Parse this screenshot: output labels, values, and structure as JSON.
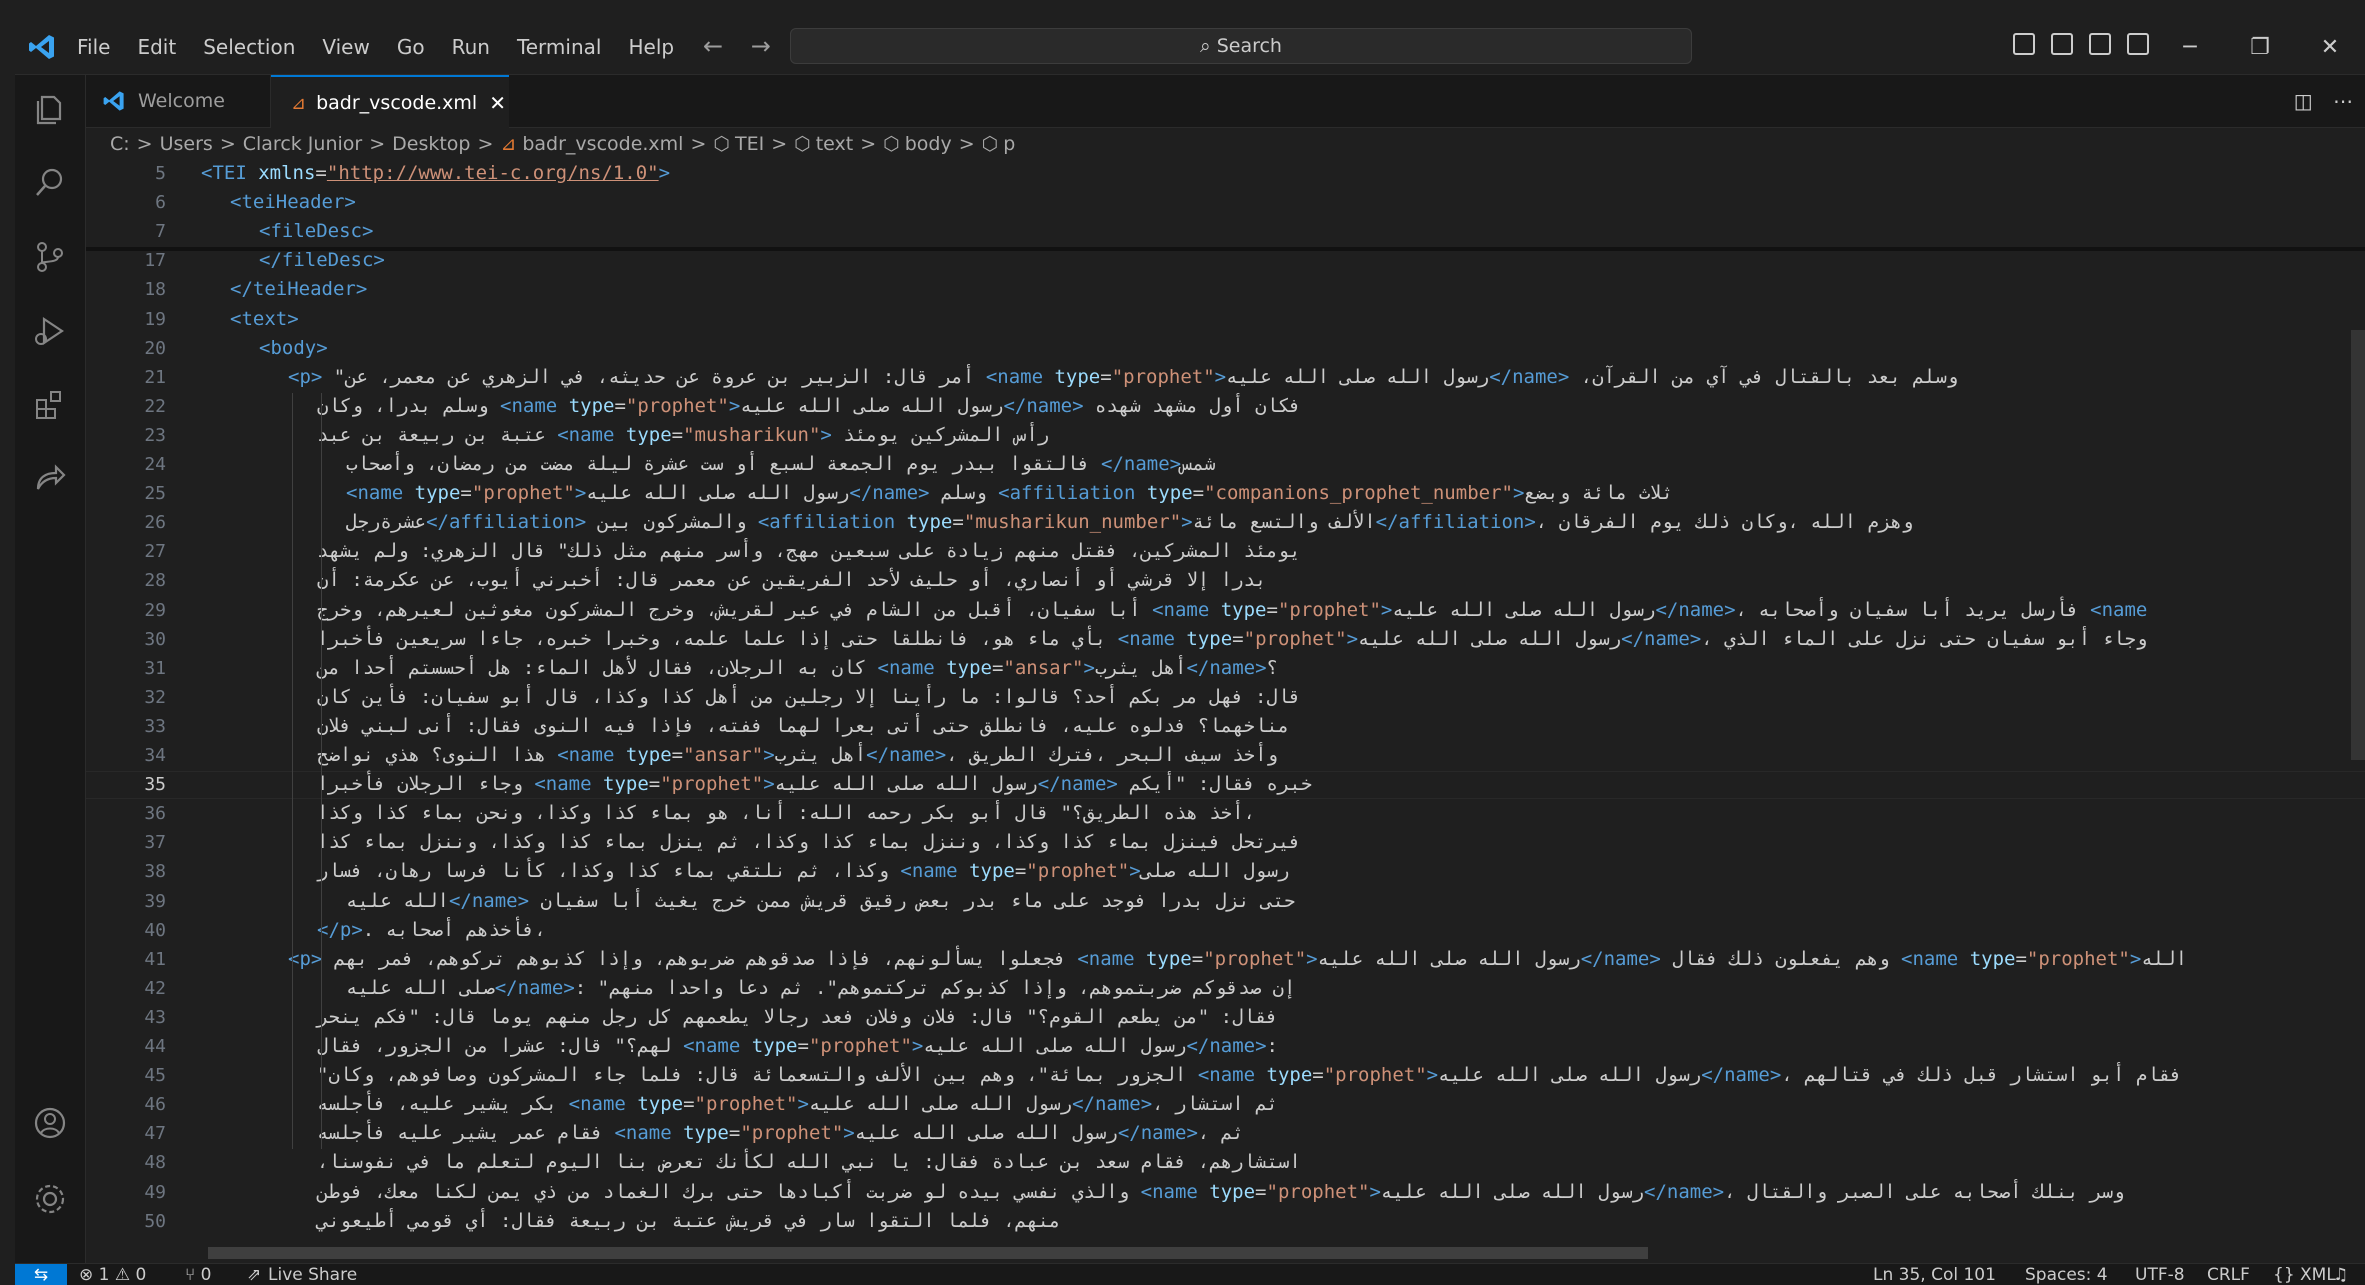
{
  "menu": [
    "File",
    "Edit",
    "Selection",
    "View",
    "Go",
    "Run",
    "Terminal",
    "Help"
  ],
  "search_label": "Search",
  "tabs": [
    {
      "label": "Welcome",
      "active": false
    },
    {
      "label": "badr_vscode.xml",
      "active": true,
      "close": "✕"
    }
  ],
  "breadcrumb": [
    "C:",
    "Users",
    "Clarck Junior",
    "Desktop",
    "badr_vscode.xml",
    "TEI",
    "text",
    "body",
    "p"
  ],
  "cursor_line": "35",
  "lines": [
    {
      "n": "5",
      "ind": 0,
      "h": "<span class=t>&lt;TEI</span> <span class=a>xmlns</span>=<span class=u>\"http://www.tei-c.org/ns/1.0\"</span><span class=t>&gt;</span>"
    },
    {
      "n": "6",
      "ind": 1,
      "h": "<span class=t>&lt;teiHeader&gt;</span>"
    },
    {
      "n": "7",
      "ind": 2,
      "h": "<span class=t>&lt;fileDesc&gt;</span>"
    },
    {
      "n": "17",
      "ind": 2,
      "h": "<span class=t>&lt;/fileDesc&gt;</span>"
    },
    {
      "n": "18",
      "ind": 1,
      "h": "<span class=t>&lt;/teiHeader&gt;</span>"
    },
    {
      "n": "19",
      "ind": 1,
      "h": "<span class=t>&lt;text&gt;</span>"
    },
    {
      "n": "20",
      "ind": 2,
      "h": "<span class=t>&lt;body&gt;</span>"
    },
    {
      "n": "21",
      "ind": 3,
      "h": "<span class=t>&lt;p&gt;</span> \"أمر قال: الزبير بن عروة عن حديثه، في الزهري عن معمر، عن <span class=t>&lt;name</span> <span class=a>type</span>=<span class=s>\"prophet\"</span><span class=t>&gt;</span>رسول الله صلى الله عليه<span class=t>&lt;/name&gt;</span> ،وسلم بعد بالقتال في آي من القرآن"
    },
    {
      "n": "22",
      "ind": 4,
      "h": "وسلم بدرا، وكان <span class=t>&lt;name</span> <span class=a>type</span>=<span class=s>\"prophet\"</span><span class=t>&gt;</span>رسول الله صلى الله عليه<span class=t>&lt;/name&gt;</span> فكان أول مشهد شهده"
    },
    {
      "n": "23",
      "ind": 4,
      "h": "عتبة بن ربيعة بن عبد <span class=t>&lt;name</span> <span class=a>type</span>=<span class=s>\"musharikun\"</span><span class=t>&gt;</span> رأس المشركين يومئذ"
    },
    {
      "n": "24",
      "ind": 5,
      "h": "فالتقوا ببدر يوم الجمعة لسبع أو ست عشرة ليلة مضت من رمضان، وأصحاب <span class=t>&lt;/name&gt;</span>شمس"
    },
    {
      "n": "25",
      "ind": 5,
      "h": "<span class=t>&lt;name</span> <span class=a>type</span>=<span class=s>\"prophet\"</span><span class=t>&gt;</span>رسول الله صلى الله عليه<span class=t>&lt;/name&gt;</span> وسلم <span class=t>&lt;affiliation</span> <span class=a>type</span>=<span class=s>\"companions_prophet_number\"</span><span class=t>&gt;</span>ثلاث مائة وبضع"
    },
    {
      "n": "26",
      "ind": 5,
      "h": "عشرةرجل<span class=t>&lt;/affiliation&gt;</span> والمشركون بين <span class=t>&lt;affiliation</span> <span class=a>type</span>=<span class=s>\"musharikun_number\"</span><span class=t>&gt;</span>الألف والتسع مائة<span class=t>&lt;/affiliation&gt;</span>، وهزم الله ،وكان ذلك يوم الفرقان"
    },
    {
      "n": "27",
      "ind": 4,
      "h": "يومئذ المشركين، فقتل منهم زيادة على سبعين مهج، وأسر منهم مثل ذلك\" قال الزهري: ولم يشهد"
    },
    {
      "n": "28",
      "ind": 4,
      "h": "بدرا إلا قرشي أو أنصاري، أو حليف لأحد الفريقين عن معمر قال: أخبرني أيوب، عن عكرمة: أن"
    },
    {
      "n": "29",
      "ind": 4,
      "h": "أبا سفيان، أقبل من الشام في عير لقريش، وخرج المشركون مغوثين لعيرهم، وخرج <span class=t>&lt;name</span> <span class=a>type</span>=<span class=s>\"prophet\"</span><span class=t>&gt;</span>رسول الله صلى الله عليه<span class=t>&lt;/name&gt;</span>، فأرسل يريد أبا سفيان وأصحابه <span class=t>&lt;name</span>"
    },
    {
      "n": "30",
      "ind": 4,
      "h": "بأي ماء هو، فانطلقا حتى إذا علما علمه، وخبرا خبره، جاءا سريعين فأخبرا <span class=t>&lt;name</span> <span class=a>type</span>=<span class=s>\"prophet\"</span><span class=t>&gt;</span>رسول الله صلى الله عليه<span class=t>&lt;/name&gt;</span>، وجاء أبو سفيان حتى نزل على الماء الذي"
    },
    {
      "n": "31",
      "ind": 4,
      "h": "كان به الرجلان، فقال لأهل الماء: هل أحسستم أحدا من <span class=t>&lt;name</span> <span class=a>type</span>=<span class=s>\"ansar\"</span><span class=t>&gt;</span>أهل يثرب<span class=t>&lt;/name&gt;</span>؟"
    },
    {
      "n": "32",
      "ind": 4,
      "h": "قال: فهل مر بكم أحد؟ قالوا: ما رأينا إلا رجلين من أهل كذا وكذا، قال أبو سفيان: فأين كان"
    },
    {
      "n": "33",
      "ind": 4,
      "h": "مناخهما؟ فدلوه عليه، فانطلق حتى أتى بعرا لهما ففته، فإذا فيه النوى فقال: أنى لبني فلان"
    },
    {
      "n": "34",
      "ind": 4,
      "h": "هذا النوى؟ هذي نواضح <span class=t>&lt;name</span> <span class=a>type</span>=<span class=s>\"ansar\"</span><span class=t>&gt;</span>أهل يثرب<span class=t>&lt;/name&gt;</span>، وأخذ سيف البحر ،فترك الطريق"
    },
    {
      "n": "35",
      "ind": 4,
      "h": "وجاء الرجلان فأخبرا <span class=t>&lt;name</span> <span class=a>type</span>=<span class=s>\"prophet\"</span><span class=t>&gt;</span>رسول الله صلى الله عليه<span class=t>&lt;/name&gt;</span> خبره فقال: \"أيكم"
    },
    {
      "n": "36",
      "ind": 4,
      "h": "أخذ هذه الطريق؟\" قال أبو بكر رحمه الله: أنا، هو بماء كذا وكذا، ونحن بماء كذا وكذا،"
    },
    {
      "n": "37",
      "ind": 4,
      "h": "فيرتحل فينزل بماء كذا وكذا، وننزل بماء كذا وكذا، ثم ينزل بماء كذا وكذا، وننزل بماء كذا"
    },
    {
      "n": "38",
      "ind": 4,
      "h": "وكذا، ثم نلتقي بماء كذا وكذا، كأنا فرسا رهان، فسار <span class=t>&lt;name</span> <span class=a>type</span>=<span class=s>\"prophet\"</span><span class=t>&gt;</span>رسول الله صلى"
    },
    {
      "n": "39",
      "ind": 5,
      "h": "الله عليه<span class=t>&lt;/name&gt;</span> حتى نزل بدرا فوجد على ماء بدر بعض رقيق قريش ممن خرج يغيث أبا سفيان"
    },
    {
      "n": "40",
      "ind": 4,
      "h": "<span class=t>&lt;/p&gt;</span>. فأخذهم أصحابه،"
    },
    {
      "n": "41",
      "ind": 3,
      "h": "<span class=t>&lt;p&gt;</span> فجعلوا يسألونهم، فإذا صدقوهم ضربوهم، وإذا كذبوهم تركوهم، فمر بهم <span class=t>&lt;name</span> <span class=a>type</span>=<span class=s>\"prophet\"</span><span class=t>&gt;</span>رسول الله صلى الله عليه<span class=t>&lt;/name&gt;</span> وهم يفعلون ذلك فقال <span class=t>&lt;name</span> <span class=a>type</span>=<span class=s>\"prophet\"</span><span class=t>&gt;</span>الله"
    },
    {
      "n": "42",
      "ind": 5,
      "h": "صلى الله عليه<span class=t>&lt;/name&gt;</span>: \"إن صدقوكم ضربتموهم، وإذا كذبوكم تركتموهم\". ثم دعا واحدا منهم"
    },
    {
      "n": "43",
      "ind": 4,
      "h": "فقال: \"من يطعم القوم؟\" قال: فلان وفلان فعد رجالا يطعمهم كل رجل منهم يوما قال: \"فكم ينحر"
    },
    {
      "n": "44",
      "ind": 4,
      "h": "لهم؟\" قال: عشرا من الجزور، فقال <span class=t>&lt;name</span> <span class=a>type</span>=<span class=s>\"prophet\"</span><span class=t>&gt;</span>رسول الله صلى الله عليه<span class=t>&lt;/name&gt;</span>:"
    },
    {
      "n": "45",
      "ind": 4,
      "h": "\"الجزور بمائة\"، وهم بين الألف والتسعمائة قال: فلما جاء المشركون وصافوهم، وكان <span class=t>&lt;name</span> <span class=a>type</span>=<span class=s>\"prophet\"</span><span class=t>&gt;</span>رسول الله صلى الله عليه<span class=t>&lt;/name&gt;</span>، فقام أبو استشار قبل ذلك في قتالهم"
    },
    {
      "n": "46",
      "ind": 4,
      "h": "بكر يشير عليه، فأجلسه <span class=t>&lt;name</span> <span class=a>type</span>=<span class=s>\"prophet\"</span><span class=t>&gt;</span>رسول الله صلى الله عليه<span class=t>&lt;/name&gt;</span>، ثم استشار"
    },
    {
      "n": "47",
      "ind": 4,
      "h": "فقام عمر يشير عليه فأجلسه <span class=t>&lt;name</span> <span class=a>type</span>=<span class=s>\"prophet\"</span><span class=t>&gt;</span>رسول الله صلى الله عليه<span class=t>&lt;/name&gt;</span>، ثم"
    },
    {
      "n": "48",
      "ind": 4,
      "h": "،استشارهم، فقام سعد بن عبادة فقال: يا نبي الله لكأنك تعرض بنا اليوم لتعلم ما في نفوسنا"
    },
    {
      "n": "49",
      "ind": 4,
      "h": "والذي نفسي بيده لو ضربت أكبادها حتى برك الغماد من ذي يمن لكنا معك، فوطن <span class=t>&lt;name</span> <span class=a>type</span>=<span class=s>\"prophet\"</span><span class=t>&gt;</span>رسول الله صلى الله عليه<span class=t>&lt;/name&gt;</span>، وسر بنلك أصحابه على الصبر والقتال"
    },
    {
      "n": "50",
      "ind": 4,
      "h": "منهم، فلما التقوا سار في قريش عتبة بن ربيعة فقال: أي قومي أطيعوني"
    }
  ],
  "status": {
    "remote_icon": "⇆",
    "problems": "⊗ 1 ⚠ 0",
    "ports": "⑂ 0",
    "live_share": "Live Share",
    "position": "Ln 35, Col 101",
    "spaces": "Spaces: 4",
    "encoding": "UTF-8",
    "eol": "CRLF",
    "language": "{} XML",
    "bell_icon": "🔔"
  },
  "colors": {
    "tag": "#569cd6",
    "attr": "#9cdcfe",
    "string": "#ce9178",
    "accent": "#0078d4"
  }
}
